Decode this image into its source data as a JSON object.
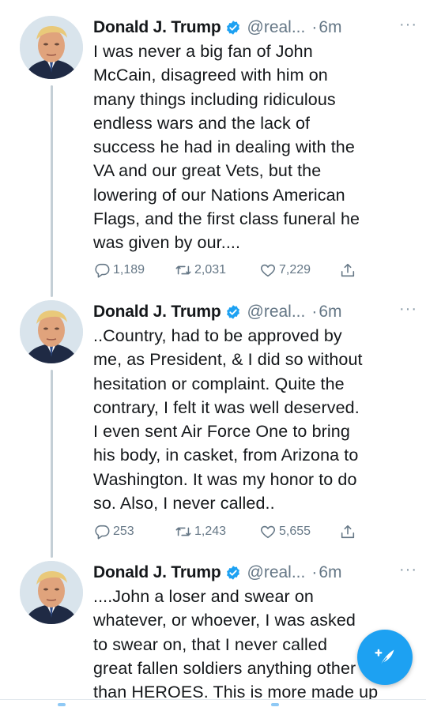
{
  "tweets": [
    {
      "author_name": "Donald J. Trump",
      "handle": "@real...",
      "separator": "·",
      "time": "6m",
      "more": "···",
      "text": "I was never a big fan of John\nMcCain, disagreed with him on\nmany things including ridiculous\nendless wars and the lack of\nsuccess he had in dealing with the\nVA and our great Vets, but the\nlowering of our Nations American\nFlags, and the first class funeral he\nwas given by our....",
      "replies": "1,189",
      "retweets": "2,031",
      "likes": "7,229"
    },
    {
      "author_name": "Donald J. Trump",
      "handle": "@real...",
      "separator": "·",
      "time": "6m",
      "more": "···",
      "text": "..Country, had to be approved by\nme, as President, & I did so without\nhesitation  or complaint. Quite the\ncontrary, I felt it was well deserved.\nI even sent Air Force One to bring\nhis body, in casket, from Arizona to\nWashington. It was my honor to do\nso. Also, I never called..",
      "replies": "253",
      "retweets": "1,243",
      "likes": "5,655"
    },
    {
      "author_name": "Donald J. Trump",
      "handle": "@real...",
      "separator": "·",
      "time": "6m",
      "more": "···",
      "text": "....John a loser and swear on\nwhatever, or whoever, I was asked\nto swear on, that I never called\ngreat fallen soldiers anything other\nthan HEROES. This is more made up",
      "replies": "",
      "retweets": "",
      "likes": ""
    }
  ],
  "icons": {
    "verified": "verified-badge-icon",
    "reply": "reply-icon",
    "retweet": "retweet-icon",
    "like": "heart-icon",
    "share": "share-icon",
    "compose": "compose-tweet-icon"
  },
  "colors": {
    "accent": "#1da1f2",
    "text": "#14171a",
    "secondary": "#657786",
    "thread_line": "#c4cfd6"
  }
}
